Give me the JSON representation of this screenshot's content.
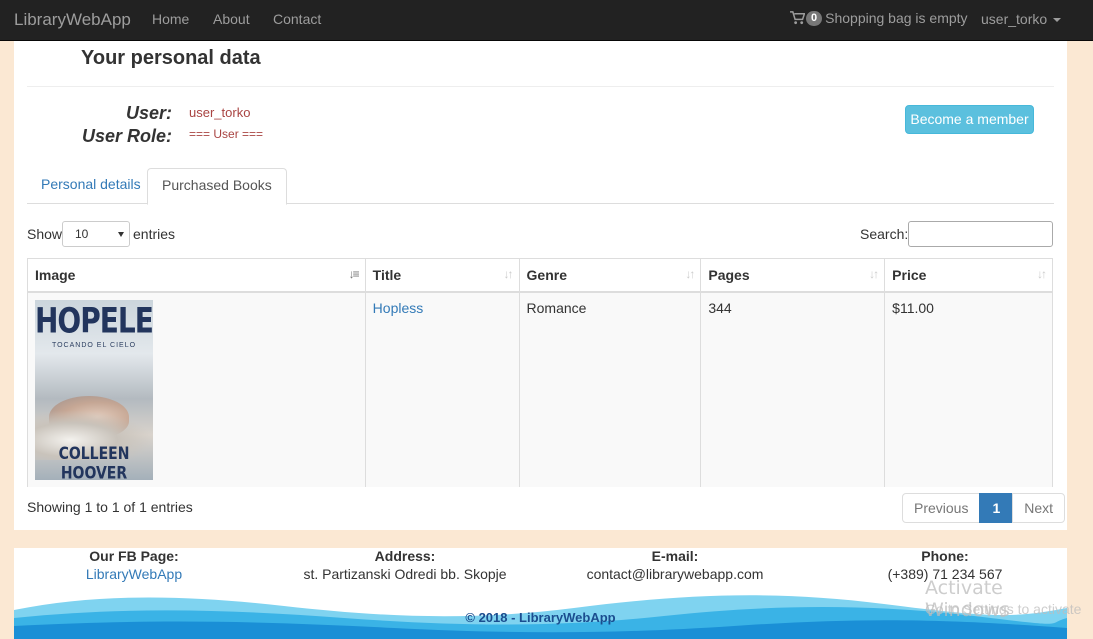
{
  "navbar": {
    "brand": "LibraryWebApp",
    "links": [
      "Home",
      "About",
      "Contact"
    ],
    "cart_count": "0",
    "cart_text": "Shopping bag is empty",
    "user": "user_torko"
  },
  "profile": {
    "title": "Your personal data",
    "user_label": "User:",
    "user_value": "user_torko",
    "role_label": "User Role:",
    "role_value": "=== User ===",
    "member_button": "Become a member"
  },
  "tabs": [
    "Personal details",
    "Purchased Books"
  ],
  "table": {
    "show_label": "Show",
    "length_value": "10",
    "entries_label": "entries",
    "search_label": "Search:",
    "search_value": "",
    "columns": [
      "Image",
      "Title",
      "Genre",
      "Pages",
      "Price"
    ],
    "rows": [
      {
        "cover": {
          "title": "HOPELESS",
          "subtitle": "TOCANDO EL CIELO",
          "author": "COLLEEN HOOVER"
        },
        "title": "Hopless",
        "genre": "Romance",
        "pages": "344",
        "price": "$11.00"
      }
    ],
    "info": "Showing 1 to 1 of 1 entries",
    "pager": {
      "previous": "Previous",
      "current": "1",
      "next": "Next"
    }
  },
  "footer": {
    "fb_label": "Our FB Page:",
    "fb_value": "LibraryWebApp",
    "address_label": "Address:",
    "address_value": "st. Partizanski Odredi bb. Skopje",
    "email_label": "E-mail:",
    "email_value": "contact@librarywebapp.com",
    "phone_label": "Phone:",
    "phone_value": "(+389) 71 234 567",
    "copyright": "© 2018 - LibraryWebApp"
  },
  "watermark": {
    "title": "Activate Windows",
    "subtitle": "Go to Settings to activate"
  },
  "colors": {
    "navbar_bg": "#222222",
    "link": "#337ab7",
    "info_button": "#5bc0de",
    "danger_text": "#a94442",
    "page_bg": "#fbe8d3"
  }
}
